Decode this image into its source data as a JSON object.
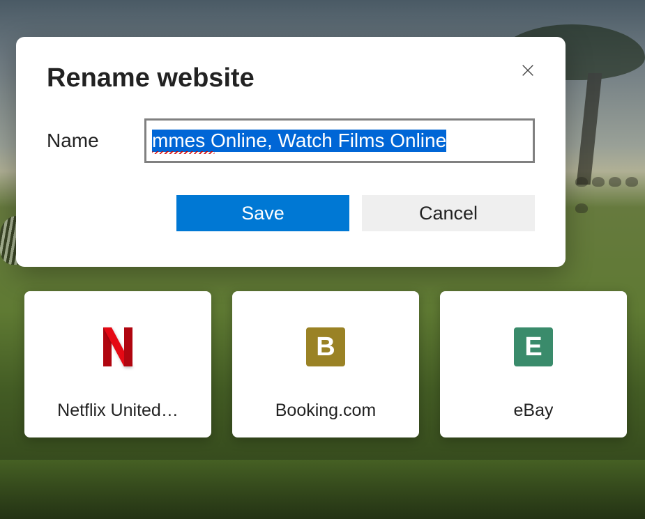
{
  "dialog": {
    "title": "Rename website",
    "name_label": "Name",
    "name_value": "mmes Online, Watch Films Online",
    "save_label": "Save",
    "cancel_label": "Cancel"
  },
  "tiles": [
    {
      "id": "netflix",
      "label": "Netflix United…",
      "icon_letter": "N"
    },
    {
      "id": "booking",
      "label": "Booking.com",
      "icon_letter": "B"
    },
    {
      "id": "ebay",
      "label": "eBay",
      "icon_letter": "E"
    }
  ]
}
